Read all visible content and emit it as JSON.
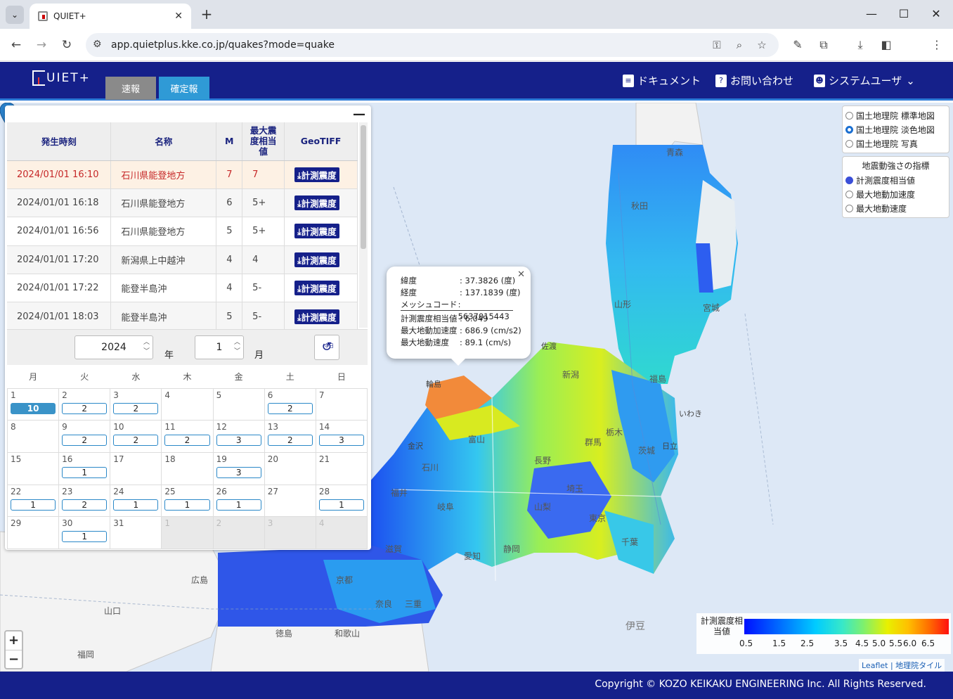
{
  "browser": {
    "tab_title": "QUIET+",
    "url": "app.quietplus.kke.co.jp/quakes?mode=quake"
  },
  "header": {
    "logo": "UIET+",
    "tabs": [
      {
        "label": "速報",
        "active": false
      },
      {
        "label": "確定報",
        "active": true
      }
    ],
    "links": {
      "docs": "ドキュメント",
      "contact": "お問い合わせ",
      "user": "システムユーザ"
    }
  },
  "quake_table": {
    "headers": {
      "time": "発生時刻",
      "name": "名称",
      "m": "M",
      "max_intensity": "最大震度相当値",
      "geotiff": "GeoTIFF"
    },
    "download_label": "計測震度",
    "rows": [
      {
        "time": "2024/01/01 16:10",
        "name": "石川県能登地方",
        "m": "7",
        "max": "7",
        "selected": true
      },
      {
        "time": "2024/01/01 16:18",
        "name": "石川県能登地方",
        "m": "6",
        "max": "5+"
      },
      {
        "time": "2024/01/01 16:56",
        "name": "石川県能登地方",
        "m": "5",
        "max": "5+"
      },
      {
        "time": "2024/01/01 17:20",
        "name": "新潟県上中越沖",
        "m": "4",
        "max": "4"
      },
      {
        "time": "2024/01/01 17:22",
        "name": "能登半島沖",
        "m": "4",
        "max": "5-"
      },
      {
        "time": "2024/01/01 18:03",
        "name": "能登半島沖",
        "m": "5",
        "max": "5-"
      }
    ]
  },
  "calendar": {
    "year": "2024",
    "year_unit": "年",
    "month": "1",
    "month_unit": "月",
    "today_label": "今日",
    "weekdays": [
      "月",
      "火",
      "水",
      "木",
      "金",
      "土",
      "日"
    ],
    "weeks": [
      [
        {
          "d": "1",
          "c": "10",
          "hot": true
        },
        {
          "d": "2",
          "c": "2"
        },
        {
          "d": "3",
          "c": "2"
        },
        {
          "d": "4"
        },
        {
          "d": "5"
        },
        {
          "d": "6",
          "c": "2"
        },
        {
          "d": "7"
        }
      ],
      [
        {
          "d": "8"
        },
        {
          "d": "9",
          "c": "2"
        },
        {
          "d": "10",
          "c": "2"
        },
        {
          "d": "11",
          "c": "2"
        },
        {
          "d": "12",
          "c": "3"
        },
        {
          "d": "13",
          "c": "2"
        },
        {
          "d": "14",
          "c": "3"
        }
      ],
      [
        {
          "d": "15"
        },
        {
          "d": "16",
          "c": "1"
        },
        {
          "d": "17"
        },
        {
          "d": "18"
        },
        {
          "d": "19",
          "c": "3"
        },
        {
          "d": "20"
        },
        {
          "d": "21"
        }
      ],
      [
        {
          "d": "22",
          "c": "1"
        },
        {
          "d": "23",
          "c": "2"
        },
        {
          "d": "24",
          "c": "1"
        },
        {
          "d": "25",
          "c": "1"
        },
        {
          "d": "26",
          "c": "1"
        },
        {
          "d": "27"
        },
        {
          "d": "28",
          "c": "1"
        }
      ],
      [
        {
          "d": "29"
        },
        {
          "d": "30",
          "c": "1"
        },
        {
          "d": "31"
        },
        {
          "d": "1",
          "out": true
        },
        {
          "d": "2",
          "out": true
        },
        {
          "d": "3",
          "out": true
        },
        {
          "d": "4",
          "out": true
        }
      ]
    ]
  },
  "popup": {
    "rows": [
      {
        "k": "緯度",
        "v": ": 37.3826 (度)"
      },
      {
        "k": "経度",
        "v": ": 137.1839 (度)"
      },
      {
        "k": "メッシュコード",
        "v": ": 5637015443"
      },
      {
        "k": "計測震度相当値",
        "v": ": 6.049"
      },
      {
        "k": "最大地動加速度",
        "v": ": 686.9 (cm/s2)"
      },
      {
        "k": "最大地動速度",
        "v": ": 89.1 (cm/s)"
      }
    ]
  },
  "basemap_options": [
    {
      "label": "国土地理院 標準地図",
      "checked": false
    },
    {
      "label": "国土地理院 淡色地図",
      "checked": true
    },
    {
      "label": "国土地理院 写真",
      "checked": false
    }
  ],
  "index_control": {
    "title": "地震動強さの指標",
    "options": [
      {
        "label": "計測震度相当値",
        "checked": true
      },
      {
        "label": "最大地動加速度",
        "checked": false
      },
      {
        "label": "最大地動速度",
        "checked": false
      }
    ]
  },
  "legend": {
    "title": "計測震度相当値",
    "ticks": [
      "0.5",
      "1.5",
      "2.5",
      "3.5",
      "4.5",
      "5.0",
      "5.5",
      "6.0",
      "6.5"
    ]
  },
  "map_labels": [
    "青森",
    "秋田",
    "山形",
    "宮城",
    "福島",
    "新潟",
    "石川",
    "富山",
    "長野",
    "群馬",
    "栃木",
    "茨城",
    "埼玉",
    "東京",
    "千葉",
    "山梨",
    "静岡",
    "愛知",
    "岐阜",
    "福井",
    "滋賀",
    "京都",
    "奈良",
    "三重",
    "広島",
    "山口",
    "福岡",
    "徳島",
    "和歌山",
    "伊豆",
    "輪島",
    "金沢",
    "日立",
    "いわき",
    "佐渡"
  ],
  "attribution": {
    "leaflet": "Leaflet",
    "tile": "地理院タイル"
  },
  "footer": "Copyright © KOZO KEIKAKU ENGINEERING Inc. All Rights Reserved."
}
